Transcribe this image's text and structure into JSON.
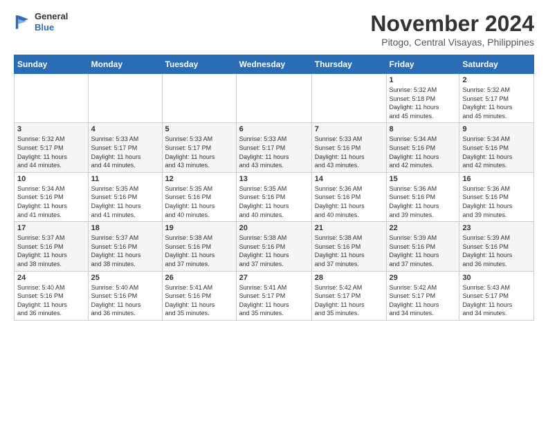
{
  "logo": {
    "general": "General",
    "blue": "Blue"
  },
  "header": {
    "month": "November 2024",
    "location": "Pitogo, Central Visayas, Philippines"
  },
  "weekdays": [
    "Sunday",
    "Monday",
    "Tuesday",
    "Wednesday",
    "Thursday",
    "Friday",
    "Saturday"
  ],
  "rows": [
    [
      {
        "day": "",
        "info": ""
      },
      {
        "day": "",
        "info": ""
      },
      {
        "day": "",
        "info": ""
      },
      {
        "day": "",
        "info": ""
      },
      {
        "day": "",
        "info": ""
      },
      {
        "day": "1",
        "info": "Sunrise: 5:32 AM\nSunset: 5:18 PM\nDaylight: 11 hours\nand 45 minutes."
      },
      {
        "day": "2",
        "info": "Sunrise: 5:32 AM\nSunset: 5:17 PM\nDaylight: 11 hours\nand 45 minutes."
      }
    ],
    [
      {
        "day": "3",
        "info": "Sunrise: 5:32 AM\nSunset: 5:17 PM\nDaylight: 11 hours\nand 44 minutes."
      },
      {
        "day": "4",
        "info": "Sunrise: 5:33 AM\nSunset: 5:17 PM\nDaylight: 11 hours\nand 44 minutes."
      },
      {
        "day": "5",
        "info": "Sunrise: 5:33 AM\nSunset: 5:17 PM\nDaylight: 11 hours\nand 43 minutes."
      },
      {
        "day": "6",
        "info": "Sunrise: 5:33 AM\nSunset: 5:17 PM\nDaylight: 11 hours\nand 43 minutes."
      },
      {
        "day": "7",
        "info": "Sunrise: 5:33 AM\nSunset: 5:16 PM\nDaylight: 11 hours\nand 43 minutes."
      },
      {
        "day": "8",
        "info": "Sunrise: 5:34 AM\nSunset: 5:16 PM\nDaylight: 11 hours\nand 42 minutes."
      },
      {
        "day": "9",
        "info": "Sunrise: 5:34 AM\nSunset: 5:16 PM\nDaylight: 11 hours\nand 42 minutes."
      }
    ],
    [
      {
        "day": "10",
        "info": "Sunrise: 5:34 AM\nSunset: 5:16 PM\nDaylight: 11 hours\nand 41 minutes."
      },
      {
        "day": "11",
        "info": "Sunrise: 5:35 AM\nSunset: 5:16 PM\nDaylight: 11 hours\nand 41 minutes."
      },
      {
        "day": "12",
        "info": "Sunrise: 5:35 AM\nSunset: 5:16 PM\nDaylight: 11 hours\nand 40 minutes."
      },
      {
        "day": "13",
        "info": "Sunrise: 5:35 AM\nSunset: 5:16 PM\nDaylight: 11 hours\nand 40 minutes."
      },
      {
        "day": "14",
        "info": "Sunrise: 5:36 AM\nSunset: 5:16 PM\nDaylight: 11 hours\nand 40 minutes."
      },
      {
        "day": "15",
        "info": "Sunrise: 5:36 AM\nSunset: 5:16 PM\nDaylight: 11 hours\nand 39 minutes."
      },
      {
        "day": "16",
        "info": "Sunrise: 5:36 AM\nSunset: 5:16 PM\nDaylight: 11 hours\nand 39 minutes."
      }
    ],
    [
      {
        "day": "17",
        "info": "Sunrise: 5:37 AM\nSunset: 5:16 PM\nDaylight: 11 hours\nand 38 minutes."
      },
      {
        "day": "18",
        "info": "Sunrise: 5:37 AM\nSunset: 5:16 PM\nDaylight: 11 hours\nand 38 minutes."
      },
      {
        "day": "19",
        "info": "Sunrise: 5:38 AM\nSunset: 5:16 PM\nDaylight: 11 hours\nand 37 minutes."
      },
      {
        "day": "20",
        "info": "Sunrise: 5:38 AM\nSunset: 5:16 PM\nDaylight: 11 hours\nand 37 minutes."
      },
      {
        "day": "21",
        "info": "Sunrise: 5:38 AM\nSunset: 5:16 PM\nDaylight: 11 hours\nand 37 minutes."
      },
      {
        "day": "22",
        "info": "Sunrise: 5:39 AM\nSunset: 5:16 PM\nDaylight: 11 hours\nand 37 minutes."
      },
      {
        "day": "23",
        "info": "Sunrise: 5:39 AM\nSunset: 5:16 PM\nDaylight: 11 hours\nand 36 minutes."
      }
    ],
    [
      {
        "day": "24",
        "info": "Sunrise: 5:40 AM\nSunset: 5:16 PM\nDaylight: 11 hours\nand 36 minutes."
      },
      {
        "day": "25",
        "info": "Sunrise: 5:40 AM\nSunset: 5:16 PM\nDaylight: 11 hours\nand 36 minutes."
      },
      {
        "day": "26",
        "info": "Sunrise: 5:41 AM\nSunset: 5:16 PM\nDaylight: 11 hours\nand 35 minutes."
      },
      {
        "day": "27",
        "info": "Sunrise: 5:41 AM\nSunset: 5:17 PM\nDaylight: 11 hours\nand 35 minutes."
      },
      {
        "day": "28",
        "info": "Sunrise: 5:42 AM\nSunset: 5:17 PM\nDaylight: 11 hours\nand 35 minutes."
      },
      {
        "day": "29",
        "info": "Sunrise: 5:42 AM\nSunset: 5:17 PM\nDaylight: 11 hours\nand 34 minutes."
      },
      {
        "day": "30",
        "info": "Sunrise: 5:43 AM\nSunset: 5:17 PM\nDaylight: 11 hours\nand 34 minutes."
      }
    ]
  ]
}
